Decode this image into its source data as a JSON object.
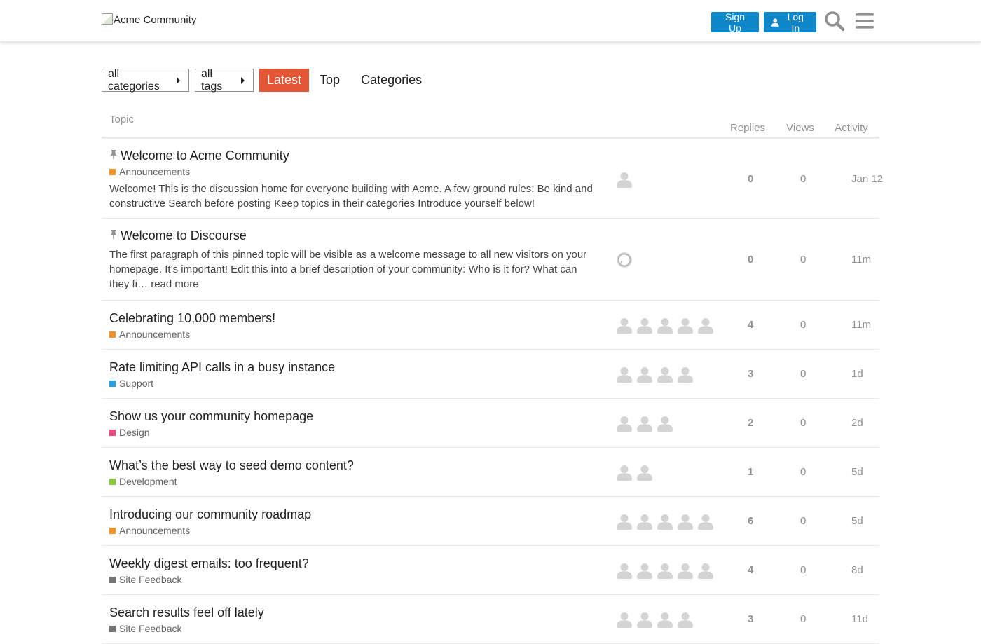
{
  "header": {
    "logo_alt": "Acme Community",
    "signup_label": "Sign Up",
    "login_label": "Log In"
  },
  "nav": {
    "categories_dropdown": "all categories",
    "tags_dropdown": "all tags",
    "tabs": [
      "Latest",
      "Top",
      "Categories"
    ],
    "active_tab": "Latest"
  },
  "colors": {
    "primary_button": "#0e86ca",
    "active_tab": "#e45735",
    "Announcements": "#f1932b",
    "Support": "#2ea2e0",
    "Design": "#ee4b7d",
    "Development": "#8cc53f",
    "Site Feedback": "#757575"
  },
  "table": {
    "columns": {
      "topic": "Topic",
      "replies": "Replies",
      "views": "Views",
      "activity": "Activity"
    },
    "rows": [
      {
        "title": "Welcome to Acme Community",
        "pinned": true,
        "category": "Announcements",
        "excerpt": "Welcome! This is the discussion home for everyone building with Acme. A few ground rules: Be kind and constructive Search before posting Keep topics in their categories Introduce yourself below!",
        "read_more": "",
        "posters": 1,
        "poster_style": "avatar",
        "replies": "0",
        "views": "0",
        "activity": "Jan 12"
      },
      {
        "title": "Welcome to Discourse",
        "pinned": true,
        "category": "",
        "excerpt": "The first paragraph of this pinned topic will be visible as a welcome message to all new visitors on your homepage. It’s important! Edit this into a brief description of your community: Who is it for? What can they fi…",
        "read_more": "read more",
        "posters": 1,
        "poster_style": "system",
        "replies": "0",
        "views": "0",
        "activity": "11m"
      },
      {
        "title": "Celebrating 10,000 members!",
        "pinned": false,
        "category": "Announcements",
        "excerpt": "",
        "read_more": "",
        "posters": 5,
        "poster_style": "avatar",
        "replies": "4",
        "views": "0",
        "activity": "11m"
      },
      {
        "title": "Rate limiting API calls in a busy instance",
        "pinned": false,
        "category": "Support",
        "excerpt": "",
        "read_more": "",
        "posters": 4,
        "poster_style": "avatar",
        "replies": "3",
        "views": "0",
        "activity": "1d"
      },
      {
        "title": "Show us your community homepage",
        "pinned": false,
        "category": "Design",
        "excerpt": "",
        "read_more": "",
        "posters": 3,
        "poster_style": "avatar",
        "replies": "2",
        "views": "0",
        "activity": "2d"
      },
      {
        "title": "What’s the best way to seed demo content?",
        "pinned": false,
        "category": "Development",
        "excerpt": "",
        "read_more": "",
        "posters": 2,
        "poster_style": "avatar",
        "replies": "1",
        "views": "0",
        "activity": "5d"
      },
      {
        "title": "Introducing our community roadmap",
        "pinned": false,
        "category": "Announcements",
        "excerpt": "",
        "read_more": "",
        "posters": 5,
        "poster_style": "avatar",
        "replies": "6",
        "views": "0",
        "activity": "5d"
      },
      {
        "title": "Weekly digest emails: too frequent?",
        "pinned": false,
        "category": "Site Feedback",
        "excerpt": "",
        "read_more": "",
        "posters": 5,
        "poster_style": "avatar",
        "replies": "4",
        "views": "0",
        "activity": "8d"
      },
      {
        "title": "Search results feel off lately",
        "pinned": false,
        "category": "Site Feedback",
        "excerpt": "",
        "read_more": "",
        "posters": 4,
        "poster_style": "avatar",
        "replies": "3",
        "views": "0",
        "activity": "11d"
      }
    ]
  }
}
